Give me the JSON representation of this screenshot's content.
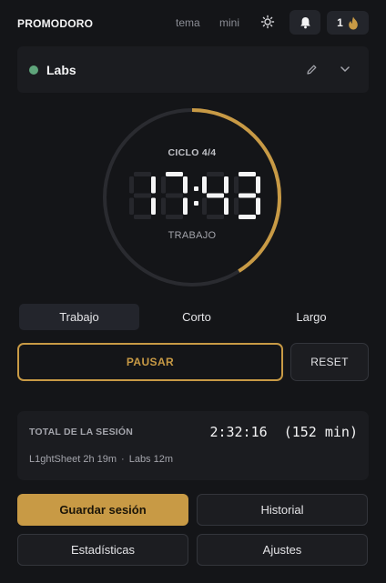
{
  "header": {
    "title": "PROMODORO",
    "theme_label": "tema",
    "mini_label": "mini",
    "sun_icon": "sun-icon",
    "bell_icon": "bell-icon",
    "streak_count": "1",
    "streak_icon": "flame-icon"
  },
  "project": {
    "name": "Labs",
    "status_color": "#5fa57b",
    "edit_icon": "pencil-icon",
    "expand_icon": "chevron-down-icon"
  },
  "timer": {
    "cycle_label": "CICLO 4/4",
    "time": "17:43",
    "phase_label": "TRABAJO",
    "progress_fraction": 0.41,
    "accent_color": "#c89a45"
  },
  "modes": {
    "items": [
      {
        "label": "Trabajo",
        "active": true
      },
      {
        "label": "Corto",
        "active": false
      },
      {
        "label": "Largo",
        "active": false
      }
    ]
  },
  "controls": {
    "pause_label": "PAUSAR",
    "reset_label": "RESET"
  },
  "session": {
    "label": "TOTAL DE LA SESIÓN",
    "total": "2:32:16  (152 min)",
    "entries": [
      "L1ghtSheet 2h 19m",
      "Labs 12m"
    ],
    "separator": "·"
  },
  "actions": {
    "save_label": "Guardar sesión",
    "history_label": "Historial",
    "stats_label": "Estadísticas",
    "settings_label": "Ajustes"
  }
}
